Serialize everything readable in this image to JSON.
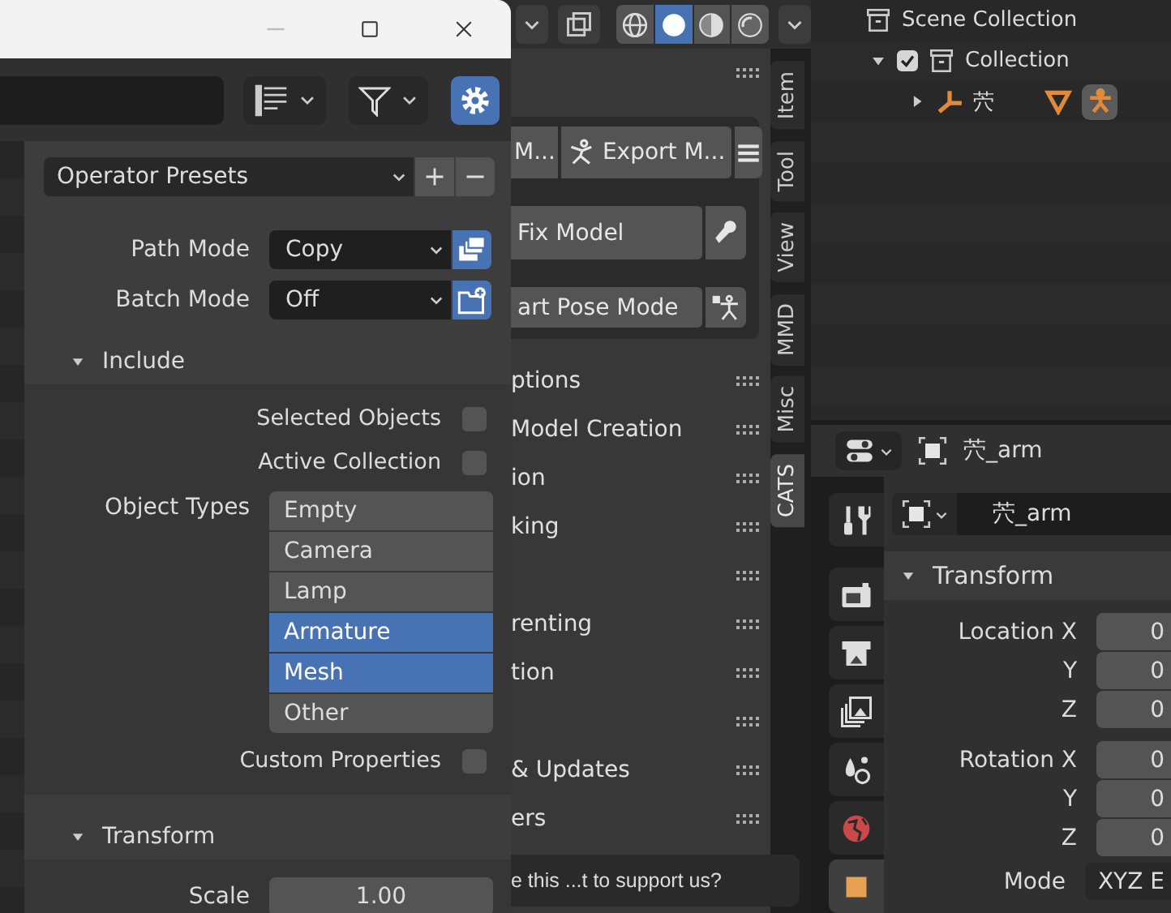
{
  "viewport": {
    "shading": [
      {
        "kind": "wireframe",
        "selected": false
      },
      {
        "kind": "solid",
        "selected": true
      },
      {
        "kind": "material",
        "selected": false
      },
      {
        "kind": "rendered",
        "selected": false
      }
    ]
  },
  "sidebar": {
    "button_rows": [
      {
        "buttons": [
          {
            "label": "M..."
          },
          {
            "label": "Export M..."
          }
        ]
      },
      {
        "buttons": [
          {
            "label": "Fix Model"
          }
        ]
      },
      {
        "buttons": [
          {
            "label": "art Pose Mode"
          }
        ]
      }
    ],
    "sections": [
      {
        "kind": "header",
        "label": "ptions"
      },
      {
        "kind": "header",
        "label": "Model Creation"
      },
      {
        "kind": "header",
        "label": "ion"
      },
      {
        "kind": "header",
        "label": "king"
      },
      {
        "kind": "blank"
      },
      {
        "kind": "header",
        "label": "renting"
      },
      {
        "kind": "header",
        "label": "tion"
      },
      {
        "kind": "blank"
      },
      {
        "kind": "header",
        "label": "& Updates"
      },
      {
        "kind": "header",
        "label": "ers"
      }
    ],
    "support_text": "e this ...t to support us?"
  },
  "tabs": [
    {
      "label": "Item",
      "selected": false
    },
    {
      "label": "Tool",
      "selected": false
    },
    {
      "label": "View",
      "selected": false
    },
    {
      "label": "MMD",
      "selected": false
    },
    {
      "label": "Misc",
      "selected": false
    },
    {
      "label": "CATS",
      "selected": true
    }
  ],
  "outliner": {
    "items": [
      {
        "kind": "scene",
        "label": "Scene Collection",
        "children": [
          {
            "kind": "collection",
            "label": "Collection",
            "checked": true,
            "expanded": true,
            "children": [
              {
                "kind": "armature",
                "label": "茓",
                "expanded": false,
                "data": [
                  {
                    "kind": "mesh",
                    "selected": false
                  },
                  {
                    "kind": "armature",
                    "selected": true
                  }
                ]
              }
            ]
          }
        ]
      }
    ]
  },
  "properties": {
    "object_name": "茓_arm",
    "data_name": "茓_arm",
    "tabs": [
      {
        "kind": "tool",
        "selected": false
      },
      {
        "kind": "render",
        "selected": false
      },
      {
        "kind": "output",
        "selected": false
      },
      {
        "kind": "view_layer",
        "selected": false
      },
      {
        "kind": "scene",
        "selected": false
      },
      {
        "kind": "world",
        "selected": false
      },
      {
        "kind": "object",
        "selected": true
      }
    ],
    "transform": {
      "title": "Transform",
      "expanded": true,
      "groups": [
        {
          "fields": [
            {
              "label": "Location X",
              "value": "0"
            },
            {
              "label": "Y",
              "value": "0"
            },
            {
              "label": "Z",
              "value": "0"
            }
          ]
        },
        {
          "fields": [
            {
              "label": "Rotation X",
              "value": "0"
            },
            {
              "label": "Y",
              "value": "0"
            },
            {
              "label": "Z",
              "value": "0"
            }
          ]
        },
        {
          "fields": [
            {
              "label": "Mode",
              "value": "XYZ E"
            }
          ]
        }
      ]
    }
  },
  "dialog": {
    "settings": {
      "on": true
    },
    "presets": "Operator Presets",
    "options": [
      {
        "label": "Path Mode",
        "value": "Copy",
        "kind": "path",
        "on": true
      },
      {
        "label": "Batch Mode",
        "value": "Off",
        "kind": "batch",
        "on": true
      }
    ],
    "panels": [
      {
        "title": "Include",
        "expanded": true,
        "rows": [
          {
            "kind": "checkbox",
            "label": "Selected Objects",
            "checked": false
          },
          {
            "kind": "checkbox",
            "label": "Active Collection",
            "checked": false
          },
          {
            "kind": "multi_select",
            "label": "Object Types",
            "items": [
              {
                "label": "Empty",
                "selected": false
              },
              {
                "label": "Camera",
                "selected": false
              },
              {
                "label": "Lamp",
                "selected": false
              },
              {
                "label": "Armature",
                "selected": true
              },
              {
                "label": "Mesh",
                "selected": true
              },
              {
                "label": "Other",
                "selected": false
              }
            ]
          },
          {
            "kind": "checkbox",
            "label": "Custom Properties",
            "checked": false
          }
        ]
      },
      {
        "title": "Transform",
        "expanded": true,
        "rows": [
          {
            "kind": "number",
            "label": "Scale",
            "value": "1.00"
          }
        ]
      }
    ]
  }
}
